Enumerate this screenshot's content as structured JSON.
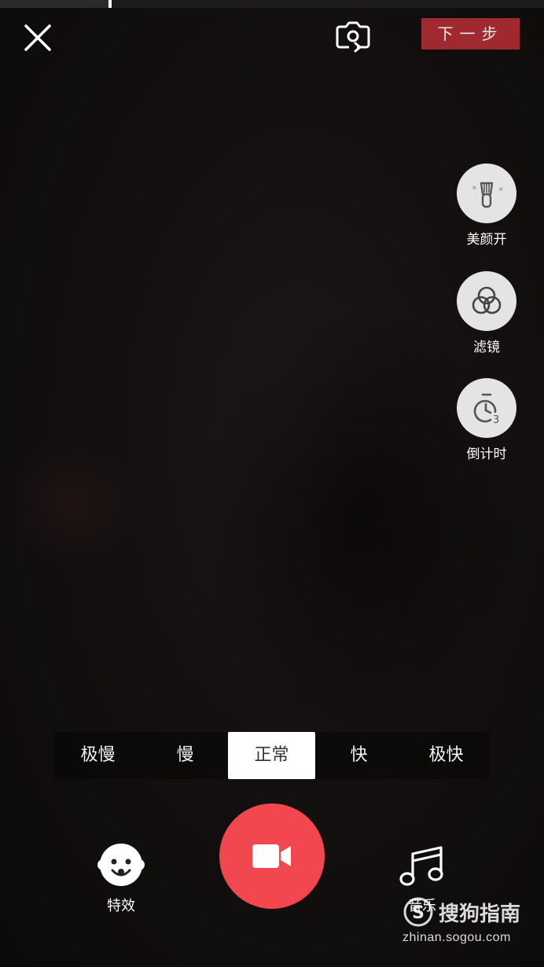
{
  "status": {
    "recording_progress": 0.2
  },
  "top_bar": {
    "close_icon": "close-icon",
    "flip_icon": "camera-flip-icon",
    "next_label": "下一步",
    "next_color": "#a0282f"
  },
  "side_tools": [
    {
      "label": "美颜开",
      "icon": "beauty-brush-icon"
    },
    {
      "label": "滤镜",
      "icon": "filter-circles-icon"
    },
    {
      "label": "倒计时",
      "icon": "countdown-timer-icon"
    }
  ],
  "speed": {
    "options": [
      "极慢",
      "慢",
      "正常",
      "快",
      "极快"
    ],
    "selected": "正常"
  },
  "bottom": {
    "effects_label": "特效",
    "effects_icon": "face-effects-icon",
    "record_icon": "video-camera-icon",
    "record_color": "#f2474f",
    "music_label": "音乐",
    "music_icon": "music-note-icon"
  },
  "watermark": {
    "brand": "搜狗指南",
    "url": "zhinan.sogou.com"
  }
}
